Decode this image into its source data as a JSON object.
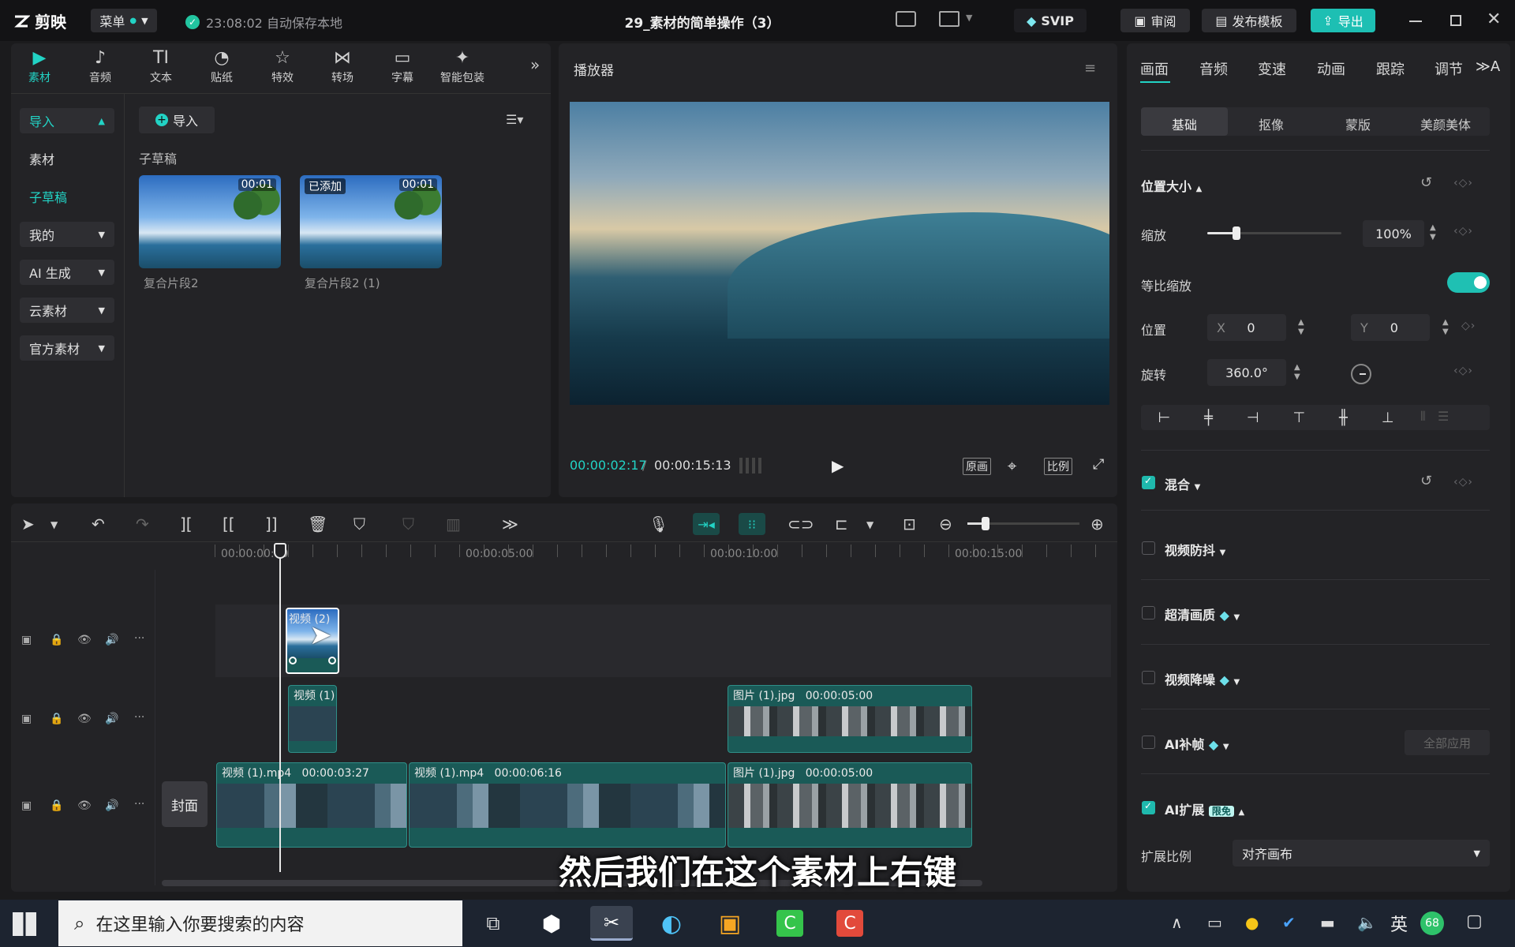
{
  "app": {
    "logo": "剪映",
    "menu_label": "菜单",
    "save_status": "23:08:02 自动保存本地",
    "project_title": "29_素材的简单操作（3）",
    "svip_label": "SVIP",
    "review_label": "审阅",
    "publish_label": "发布模板",
    "export_label": "导出"
  },
  "media_tools": [
    {
      "label": "素材",
      "icon": "media-icon"
    },
    {
      "label": "音频",
      "icon": "audio-icon"
    },
    {
      "label": "文本",
      "icon": "text-icon"
    },
    {
      "label": "贴纸",
      "icon": "sticker-icon"
    },
    {
      "label": "特效",
      "icon": "effects-icon"
    },
    {
      "label": "转场",
      "icon": "transition-icon"
    },
    {
      "label": "字幕",
      "icon": "subtitle-icon"
    },
    {
      "label": "智能包装",
      "icon": "smart-pack-icon"
    }
  ],
  "sidebar": {
    "import": "导入",
    "media": "素材",
    "sub_draft": "子草稿",
    "mine": "我的",
    "ai_gen": "AI 生成",
    "cloud": "云素材",
    "official": "官方素材"
  },
  "library": {
    "import_button": "导入",
    "section_title": "子草稿",
    "items": [
      {
        "name": "复合片段2",
        "duration": "00:01",
        "badge": ""
      },
      {
        "name": "复合片段2 (1)",
        "duration": "00:01",
        "badge": "已添加"
      }
    ]
  },
  "player": {
    "title": "播放器",
    "current_time": "00:00:02:17",
    "total_time": "00:00:15:13",
    "original_label": "原画",
    "ratio_label": "比例"
  },
  "inspector": {
    "tabs": [
      "画面",
      "音频",
      "变速",
      "动画",
      "跟踪",
      "调节"
    ],
    "subtabs": [
      "基础",
      "抠像",
      "蒙版",
      "美颜美体"
    ],
    "position_size": "位置大小",
    "scale_label": "缩放",
    "scale_value": "100%",
    "scale_level": 0.22,
    "uniform_scale": "等比缩放",
    "position_label": "位置",
    "x_label": "X",
    "x_value": "0",
    "y_label": "Y",
    "y_value": "0",
    "rotation_label": "旋转",
    "rotation_value": "360.0°",
    "blend": "混合",
    "stabilize": "视频防抖",
    "hd": "超清画质",
    "denoise": "视频降噪",
    "ai_frame": "AI补帧",
    "apply_all": "全部应用",
    "ai_expand": "AI扩展",
    "free_badge": "限免",
    "expand_ratio_label": "扩展比例",
    "expand_ratio_value": "对齐画布"
  },
  "timeline": {
    "ruler": [
      "00:00:00:00",
      "00:00:05:00",
      "00:00:10:00",
      "00:00:15:00"
    ],
    "cover_label": "封面",
    "clips": {
      "top": {
        "label": "视频 (2)"
      },
      "mid_video": {
        "label": "视频 (1)"
      },
      "mid_image": {
        "label": "图片 (1).jpg",
        "duration": "00:00:05:00"
      },
      "main_a": {
        "label": "视频 (1).mp4",
        "duration": "00:00:03:27"
      },
      "main_b": {
        "label": "视频 (1).mp4",
        "duration": "00:00:06:16"
      },
      "main_c": {
        "label": "图片 (1).jpg",
        "duration": "00:00:05:00"
      }
    }
  },
  "subtitle": "然后我们在这个素材上右键",
  "taskbar": {
    "search_placeholder": "在这里输入你要搜索的内容",
    "ime": "英",
    "badge": "68"
  },
  "colors": {
    "accent": "#22d3c5",
    "clip": "#1a5a57",
    "background": "#1b1b1d"
  }
}
